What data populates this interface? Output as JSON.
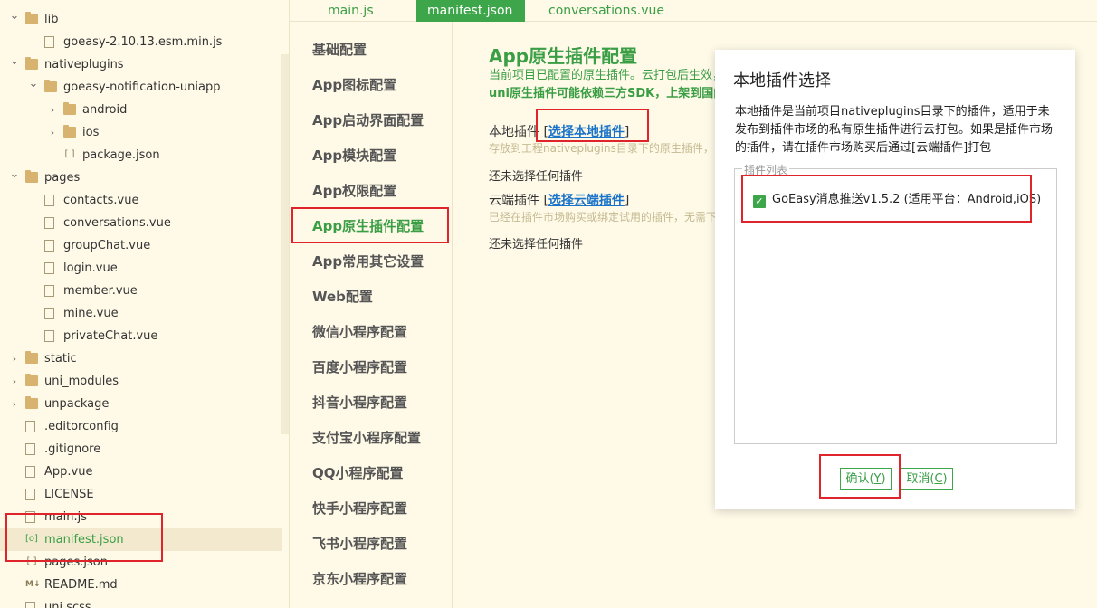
{
  "tree": {
    "items": [
      {
        "label": "lib",
        "kind": "folder",
        "expanded": true,
        "indent": 0
      },
      {
        "label": "goeasy-2.10.13.esm.min.js",
        "kind": "file",
        "indent": 1
      },
      {
        "label": "nativeplugins",
        "kind": "folder",
        "expanded": true,
        "indent": 0
      },
      {
        "label": "goeasy-notification-uniapp",
        "kind": "folder",
        "expanded": true,
        "indent": 1
      },
      {
        "label": "android",
        "kind": "folder",
        "expanded": false,
        "indent": 2
      },
      {
        "label": "ios",
        "kind": "folder",
        "expanded": false,
        "indent": 2
      },
      {
        "label": "package.json",
        "kind": "json",
        "indent": 2
      },
      {
        "label": "pages",
        "kind": "folder",
        "expanded": true,
        "indent": 0
      },
      {
        "label": "contacts.vue",
        "kind": "file",
        "indent": 1
      },
      {
        "label": "conversations.vue",
        "kind": "file",
        "indent": 1
      },
      {
        "label": "groupChat.vue",
        "kind": "file",
        "indent": 1
      },
      {
        "label": "login.vue",
        "kind": "file",
        "indent": 1
      },
      {
        "label": "member.vue",
        "kind": "file",
        "indent": 1
      },
      {
        "label": "mine.vue",
        "kind": "file",
        "indent": 1
      },
      {
        "label": "privateChat.vue",
        "kind": "file",
        "indent": 1
      },
      {
        "label": "static",
        "kind": "folder",
        "expanded": false,
        "indent": 0
      },
      {
        "label": "uni_modules",
        "kind": "folder",
        "expanded": false,
        "indent": 0
      },
      {
        "label": "unpackage",
        "kind": "folder",
        "expanded": false,
        "indent": 0
      },
      {
        "label": ".editorconfig",
        "kind": "file",
        "indent": 0
      },
      {
        "label": ".gitignore",
        "kind": "file",
        "indent": 0
      },
      {
        "label": "App.vue",
        "kind": "file",
        "indent": 0
      },
      {
        "label": "LICENSE",
        "kind": "file",
        "indent": 0
      },
      {
        "label": "main.js",
        "kind": "file",
        "indent": 0
      },
      {
        "label": "manifest.json",
        "kind": "manifest",
        "indent": 0,
        "selected": true
      },
      {
        "label": "pages.json",
        "kind": "json",
        "indent": 0
      },
      {
        "label": "README.md",
        "kind": "md",
        "indent": 0
      },
      {
        "label": "uni.scss",
        "kind": "file",
        "indent": 0
      }
    ]
  },
  "tabs": [
    {
      "label": "main.js",
      "active": false
    },
    {
      "label": "manifest.json",
      "active": true
    },
    {
      "label": "conversations.vue",
      "active": false
    }
  ],
  "menu": {
    "items": [
      {
        "label": "基础配置",
        "active": false
      },
      {
        "label": "App图标配置",
        "active": false
      },
      {
        "label": "App启动界面配置",
        "active": false
      },
      {
        "label": "App模块配置",
        "active": false
      },
      {
        "label": "App权限配置",
        "active": false
      },
      {
        "label": "App原生插件配置",
        "active": true
      },
      {
        "label": "App常用其它设置",
        "active": false
      },
      {
        "label": "Web配置",
        "active": false
      },
      {
        "label": "微信小程序配置",
        "active": false
      },
      {
        "label": "百度小程序配置",
        "active": false
      },
      {
        "label": "抖音小程序配置",
        "active": false
      },
      {
        "label": "支付宝小程序配置",
        "active": false
      },
      {
        "label": "QQ小程序配置",
        "active": false
      },
      {
        "label": "快手小程序配置",
        "active": false
      },
      {
        "label": "飞书小程序配置",
        "active": false
      },
      {
        "label": "京东小程序配置",
        "active": false
      }
    ]
  },
  "content": {
    "title": "App原生插件配置",
    "desc_line1": "当前项目已配置的原生插件。云打包后生效，",
    "desc_line2": "uni原生插件可能依赖三方SDK，上架到国内",
    "local_label": "本地插件",
    "local_link": "选择本地插件",
    "local_hint": "存放到工程nativeplugins目录下的原生插件，",
    "local_none": "还未选择任何插件",
    "cloud_label": "云端插件",
    "cloud_link": "选择云端插件",
    "cloud_hint": "已经在插件市场购买或绑定试用的插件，无需下",
    "cloud_none": "还未选择任何插件"
  },
  "dialog": {
    "title": "本地插件选择",
    "description": "本地插件是当前项目nativeplugins目录下的插件，适用于未发布到插件市场的私有原生插件进行云打包。如果是插件市场的插件，请在插件市场购买后通过[云端插件]打包",
    "list_label": "插件列表",
    "plugin_label": "GoEasy消息推送v1.5.2 (适用平台：Android,iOS)",
    "plugin_checked": true,
    "confirm_text": "确认(",
    "confirm_key": "Y",
    "cancel_text": "取消(",
    "cancel_key": "C",
    "close_paren": ")"
  },
  "colors": {
    "accent": "#3ea64a",
    "highlight": "#e0242b",
    "link": "#1a73c8",
    "background": "#fffae8"
  }
}
